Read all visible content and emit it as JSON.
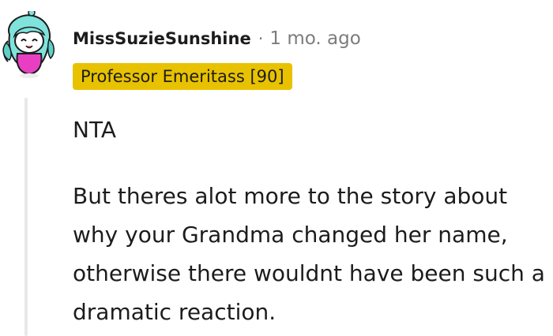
{
  "comment": {
    "author": "MissSuzieSunshine",
    "separator": "·",
    "timestamp": "1 mo. ago",
    "flair": {
      "text": "Professor Emeritass [90]",
      "background": "#e8c200"
    },
    "avatar_icon": "snoo-avatar-icon",
    "paragraphs": [
      "NTA",
      "But theres alot more to the story about why your Grandma changed her name, otherwise there wouldnt have been such a dramatic reaction."
    ]
  }
}
